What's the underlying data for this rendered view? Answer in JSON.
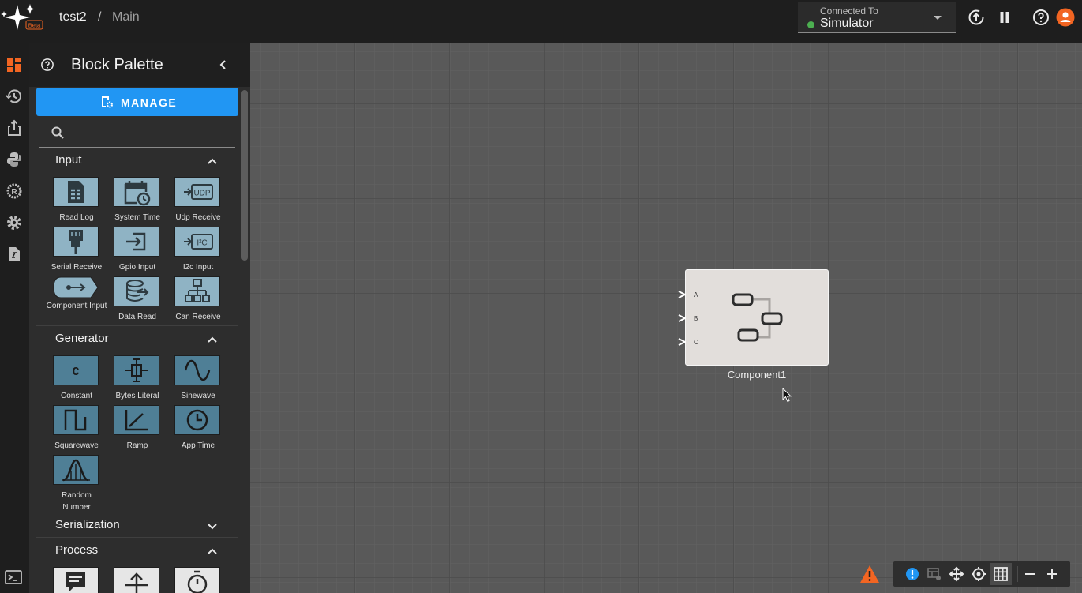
{
  "header": {
    "project": "test2",
    "separator": "/",
    "page": "Main",
    "logo_badge": "Beta",
    "connection": {
      "label": "Connected To",
      "value": "Simulator",
      "status_color": "#4caf50"
    }
  },
  "palette": {
    "title": "Block Palette",
    "manage_label": "MANAGE",
    "search_placeholder": "",
    "sections": [
      {
        "title": "Input",
        "expanded": true,
        "blocks": [
          "Read Log",
          "System Time",
          "Udp Receive",
          "Serial Receive",
          "Gpio Input",
          "I2c Input",
          "Component Input",
          "Data Read",
          "Can Receive"
        ]
      },
      {
        "title": "Generator",
        "expanded": true,
        "blocks": [
          "Constant",
          "Bytes Literal",
          "Sinewave",
          "Squarewave",
          "Ramp",
          "App Time",
          "Random Number"
        ]
      },
      {
        "title": "Serialization",
        "expanded": false,
        "blocks": []
      },
      {
        "title": "Process",
        "expanded": true,
        "blocks": []
      }
    ],
    "icon_text": {
      "udp": "UDP",
      "i2c": "I²C",
      "constant": "C"
    }
  },
  "canvas": {
    "component": {
      "name": "Component1",
      "ports": [
        "A",
        "B",
        "C"
      ]
    }
  },
  "colors": {
    "accent": "#f26522",
    "primary": "#2196f3",
    "input_tile": "#8fb3c4",
    "generator_tile": "#4f7f96"
  }
}
